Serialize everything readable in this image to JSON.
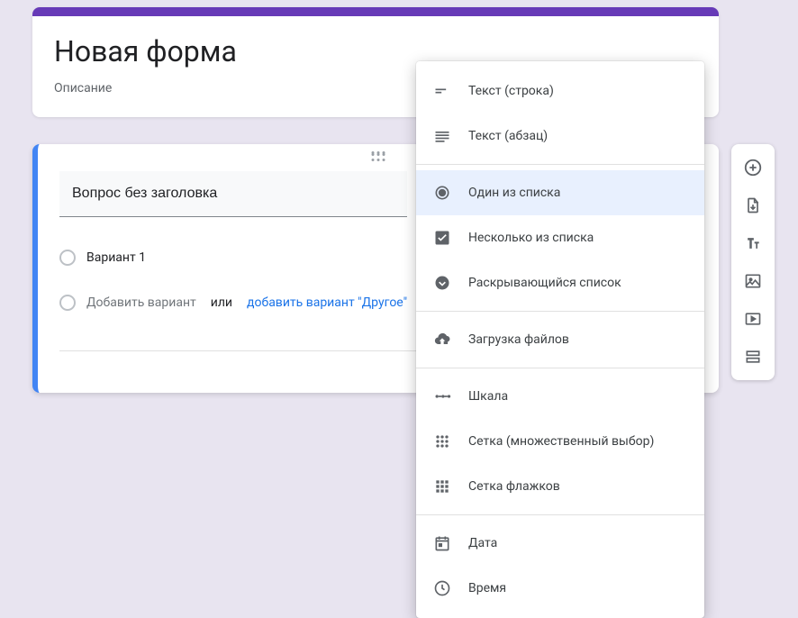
{
  "header": {
    "title": "Новая форма",
    "description": "Описание"
  },
  "question": {
    "title": "Вопрос без заголовка",
    "option1": "Вариант 1",
    "add_option_placeholder": "Добавить вариант",
    "or_text": "или",
    "add_other": "добавить вариант \"Другое\""
  },
  "type_menu": {
    "short_text": "Текст (строка)",
    "paragraph": "Текст (абзац)",
    "radio": "Один из списка",
    "checkbox": "Несколько из списка",
    "dropdown": "Раскрывающийся список",
    "file_upload": "Загрузка файлов",
    "scale": "Шкала",
    "grid_radio": "Сетка (множественный выбор)",
    "grid_checkbox": "Сетка флажков",
    "date": "Дата",
    "time": "Время",
    "selected": "radio"
  },
  "colors": {
    "accent": "#673ab7",
    "active": "#4285f4",
    "link": "#1a73e8"
  }
}
